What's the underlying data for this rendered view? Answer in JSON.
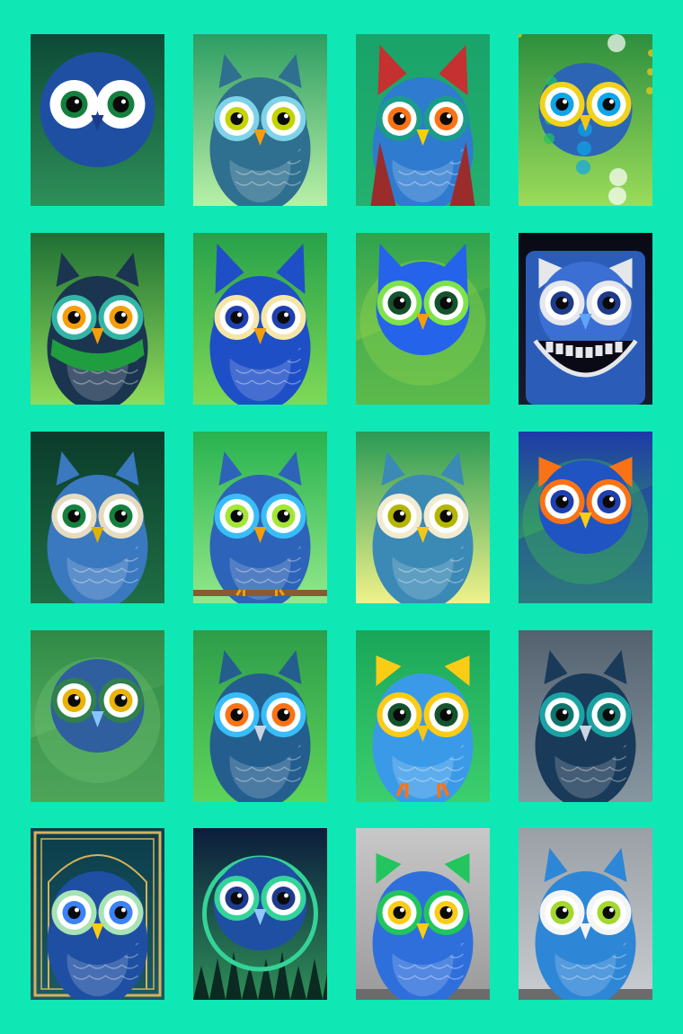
{
  "gallery": {
    "background": "#0fe8b5",
    "tiles": [
      {
        "name": "owl-tile-1",
        "bg": [
          "#0c4a36",
          "#2e8f58"
        ],
        "body": "#1f4fa3",
        "ring": "#ffffff",
        "iris": "#15803d",
        "beak": "#1e3a8a",
        "ears": "none",
        "style": "ball"
      },
      {
        "name": "owl-tile-2",
        "bg": [
          "#2d9d63",
          "#b9f0a7"
        ],
        "body": "#2f6f8f",
        "ring": "#7dd3e8",
        "iris": "#c4d400",
        "beak": "#f59e0b",
        "ears": "tufts",
        "style": "standing"
      },
      {
        "name": "owl-tile-3",
        "bg": [
          "#1aa36a",
          "#24b06e"
        ],
        "body": "#2f7bd0",
        "ring": "#1b9c8a",
        "iris": "#f97316",
        "beak": "#f5d000",
        "ears": "red",
        "style": "cloak"
      },
      {
        "name": "owl-tile-4",
        "bg": [
          "#2e8f3e",
          "#9bdc5a"
        ],
        "body": "#2b65b3",
        "ring": "#f1d21c",
        "iris": "#0ea5e9",
        "beak": "#f5c518",
        "ears": "none",
        "style": "painterly"
      },
      {
        "name": "owl-tile-5",
        "bg": [
          "#1e6f35",
          "#8fdc5a"
        ],
        "body": "#1b3550",
        "ring": "#33b5a5",
        "iris": "#f59e0b",
        "beak": "#f59e0b",
        "ears": "tufts",
        "style": "scarf"
      },
      {
        "name": "owl-tile-6",
        "bg": [
          "#27a14a",
          "#7fd957"
        ],
        "body": "#1e4fc7",
        "ring": "#f5e6a8",
        "iris": "#1e40af",
        "beak": "#f59e0b",
        "ears": "tall",
        "style": "standing"
      },
      {
        "name": "owl-tile-7",
        "bg": [
          "#2ea24e",
          "#8ed24b"
        ],
        "body": "#2563eb",
        "ring": "#7ee34b",
        "iris": "#14532d",
        "beak": "#f59e0b",
        "ears": "tall",
        "style": "geo"
      },
      {
        "name": "owl-tile-8",
        "bg": [
          "#0a0a16",
          "#1a1a2e"
        ],
        "body": "#3b6fd4",
        "ring": "#e5e7eb",
        "iris": "#1e3a8a",
        "beak": "#60a5fa",
        "ears": "box",
        "style": "smile"
      },
      {
        "name": "owl-tile-9",
        "bg": [
          "#0b3b2b",
          "#1f6f44"
        ],
        "body": "#3a78c0",
        "ring": "#e5dcc0",
        "iris": "#15803d",
        "beak": "#e0b000",
        "ears": "tufts",
        "style": "realistic"
      },
      {
        "name": "owl-tile-10",
        "bg": [
          "#28b24f",
          "#93e88a"
        ],
        "body": "#2d63b8",
        "ring": "#38bdf8",
        "iris": "#a3e635",
        "beak": "#f59e0b",
        "ears": "tufts",
        "style": "branch"
      },
      {
        "name": "owl-tile-11",
        "bg": [
          "#2a9a55",
          "#f0f28a"
        ],
        "body": "#3b89b5",
        "ring": "#f1ebd2",
        "iris": "#b5b500",
        "beak": "#f5c518",
        "ears": "tufts",
        "style": "realistic"
      },
      {
        "name": "owl-tile-12",
        "bg": [
          "#1e3aa8",
          "#3cba52"
        ],
        "body": "#1f54c2",
        "ring": "#f97316",
        "iris": "#1e40af",
        "beak": "#facc15",
        "ears": "box",
        "style": "geo"
      },
      {
        "name": "owl-tile-13",
        "bg": [
          "#2f8a46",
          "#6bbf6d"
        ],
        "body": "#2f5f9f",
        "ring": "#2f7f4f",
        "iris": "#eab308",
        "beak": "#86c5ff",
        "ears": "none",
        "style": "flat"
      },
      {
        "name": "owl-tile-14",
        "bg": [
          "#2e9d4a",
          "#5ed45a"
        ],
        "body": "#245e8f",
        "ring": "#38bdf8",
        "iris": "#f97316",
        "beak": "#cbd5e1",
        "ears": "tufts",
        "style": "realistic"
      },
      {
        "name": "owl-tile-15",
        "bg": [
          "#1aa65a",
          "#3ccf6d"
        ],
        "body": "#3b9ae8",
        "ring": "#facc15",
        "iris": "#14532d",
        "beak": "#f5c518",
        "ears": "box",
        "style": "feet"
      },
      {
        "name": "owl-tile-16",
        "bg": [
          "#546270",
          "#8797a0"
        ],
        "body": "#1a3a5a",
        "ring": "#1aa3a3",
        "iris": "#0f766e",
        "beak": "#cbd5e1",
        "ears": "tufts",
        "style": "realistic"
      },
      {
        "name": "owl-tile-17",
        "bg": [
          "#0b3d4a",
          "#1b5a63"
        ],
        "body": "#1e4fa3",
        "ring": "#a7e3b5",
        "iris": "#3b82f6",
        "beak": "#facc15",
        "ears": "none",
        "style": "ornate"
      },
      {
        "name": "owl-tile-18",
        "bg": [
          "#0c1c3c",
          "#2e8f58"
        ],
        "body": "#1f4fa3",
        "ring": "#34d399",
        "iris": "#1e3a8a",
        "beak": "#93c5fd",
        "ears": "none",
        "style": "forest"
      },
      {
        "name": "owl-tile-19",
        "bg": [
          "#c8c8c8",
          "#9a9a9a"
        ],
        "body": "#2f6fdc",
        "ring": "#22c55e",
        "iris": "#facc15",
        "beak": "#facc15",
        "ears": "box",
        "style": "mural"
      },
      {
        "name": "owl-tile-20",
        "bg": [
          "#9aa0a6",
          "#c9ccd0"
        ],
        "body": "#2e86d6",
        "ring": "#f3f4f6",
        "iris": "#a3d82f",
        "beak": "#f3f4f6",
        "ears": "tufts",
        "style": "mural"
      }
    ]
  }
}
